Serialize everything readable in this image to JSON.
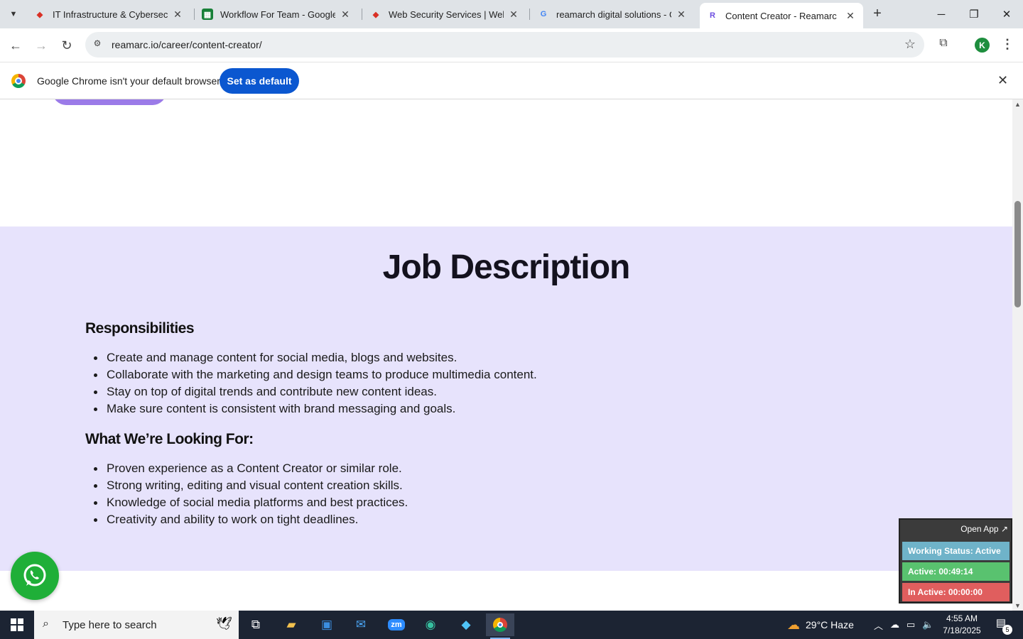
{
  "browser": {
    "tabs": [
      {
        "title": "IT Infrastructure & Cybersecurity",
        "favicon": "redbadge-icon"
      },
      {
        "title": "Workflow For Team - Google Sheets",
        "favicon": "google-sheets-icon"
      },
      {
        "title": "Web Security Services | Website",
        "favicon": "redbadge-icon"
      },
      {
        "title": "reamarch digital solutions - Google",
        "favicon": "google-icon"
      },
      {
        "title": "Content Creator - Reamarc",
        "favicon": "reamarc-icon"
      }
    ],
    "url": "reamarc.io/career/content-creator/",
    "profile_initial": "K"
  },
  "infobar": {
    "message": "Google Chrome isn't your default browser",
    "button": "Set as default"
  },
  "page": {
    "section_title": "Job Description",
    "responsibilities": {
      "heading": "Responsibilities",
      "items": [
        "Create and manage content for social media, blogs and websites.",
        "Collaborate with the marketing and design teams to produce multimedia content.",
        "Stay on top of digital trends and contribute new content ideas.",
        "Make sure content is consistent with brand messaging and goals."
      ]
    },
    "looking_for": {
      "heading": "What We’re Looking For:",
      "items": [
        "Proven experience as a Content Creator or similar role.",
        "Strong writing, editing and visual content creation skills.",
        "Knowledge of social media platforms and best practices.",
        "Creativity and ability to work on tight deadlines."
      ]
    }
  },
  "tracker": {
    "open_app": "Open App",
    "working_status": "Working Status: Active",
    "active": "Active: 00:49:14",
    "inactive": "In Active: 00:00:00"
  },
  "taskbar": {
    "search_placeholder": "Type here to search",
    "weather": "29°C  Haze",
    "time": "4:55 AM",
    "date": "7/18/2025",
    "notifications": "5"
  },
  "colors": {
    "section_bg": "#e7e3fc",
    "accent_button": "#0b57d0",
    "whatsapp": "#1faf38"
  }
}
